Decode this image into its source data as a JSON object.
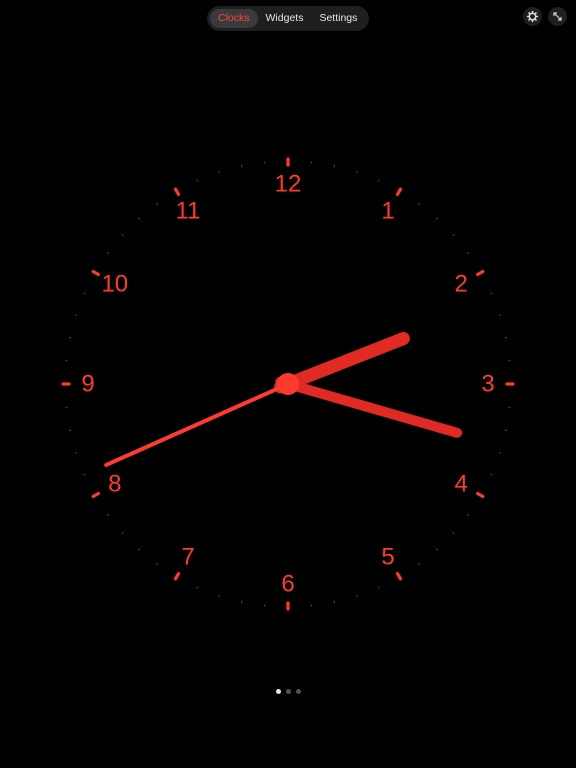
{
  "tabs": [
    {
      "label": "Clocks",
      "active": true
    },
    {
      "label": "Widgets",
      "active": false
    },
    {
      "label": "Settings",
      "active": false
    }
  ],
  "top_right": {
    "settings_icon": "gear-icon",
    "fullscreen_icon": "expand-icon"
  },
  "clock": {
    "numerals": [
      "12",
      "1",
      "2",
      "3",
      "4",
      "5",
      "6",
      "7",
      "8",
      "9",
      "10",
      "11"
    ],
    "time": {
      "hour": 2,
      "minute": 17,
      "second": 41
    },
    "colors": {
      "hands": "#e22a24",
      "second_hand": "#ff3b30",
      "numerals": "#ff3b30",
      "ticks": "#ff3b30",
      "minor_ticks": "#3a3a3a"
    }
  },
  "page_indicator": {
    "count": 3,
    "active_index": 0
  }
}
